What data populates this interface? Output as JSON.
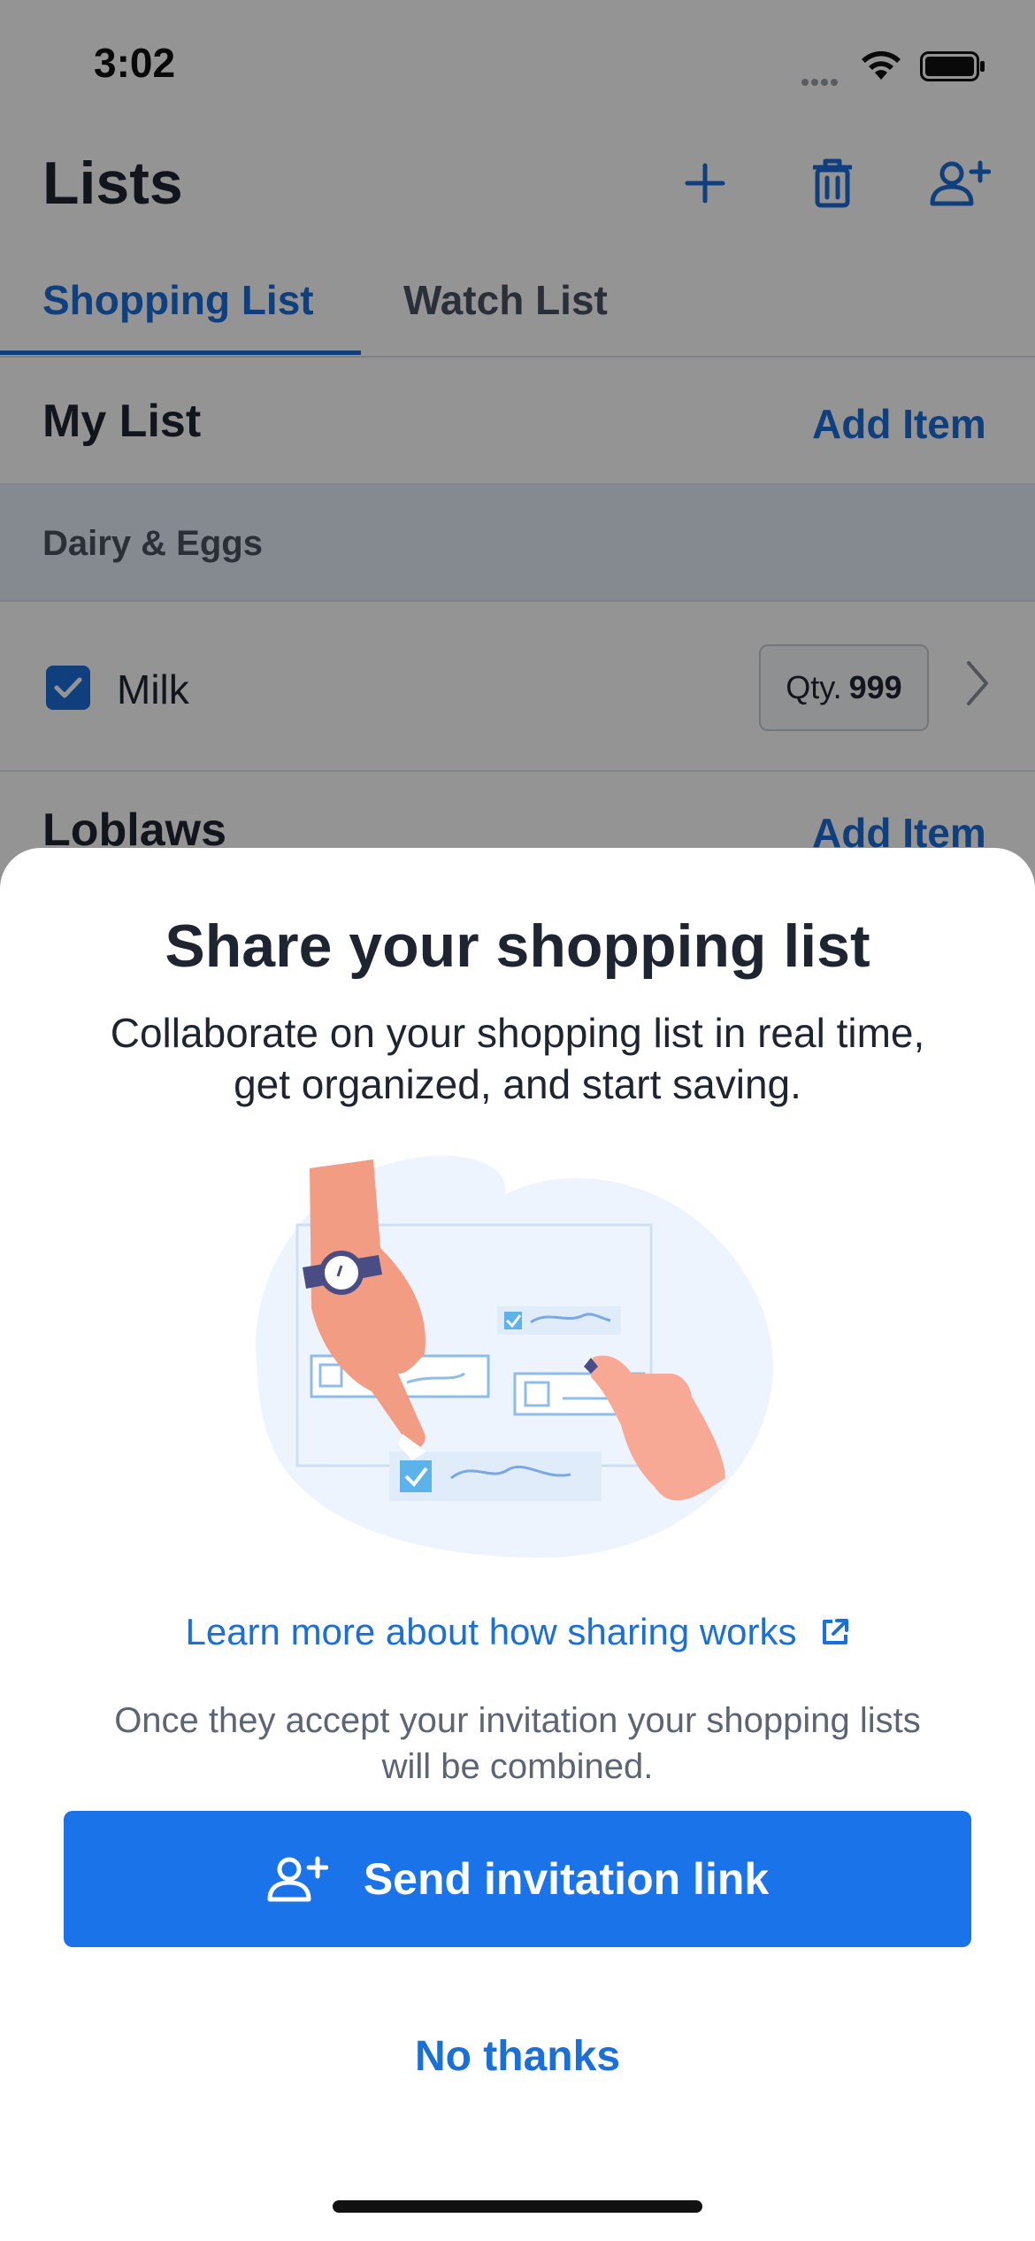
{
  "status_bar": {
    "time": "3:02"
  },
  "header": {
    "title": "Lists",
    "icons": [
      "plus-icon",
      "trash-icon",
      "person-add-icon"
    ]
  },
  "tabs": [
    {
      "label": "Shopping List",
      "active": true
    },
    {
      "label": "Watch List",
      "active": false
    }
  ],
  "lists": [
    {
      "title": "My List",
      "add_label": "Add Item",
      "sections": [
        {
          "name": "Dairy & Eggs",
          "items": [
            {
              "name": "Milk",
              "checked": true,
              "qty_label": "Qty.",
              "qty_value": "999"
            }
          ]
        }
      ]
    },
    {
      "title": "Loblaws",
      "add_label": "Add Item"
    }
  ],
  "sheet": {
    "title": "Share your shopping list",
    "description_line1": "Collaborate on your shopping list in real time,",
    "description_line2": "get organized, and start saving.",
    "learn_more": "Learn more about how sharing works",
    "note_line1": "Once they accept your invitation your shopping lists",
    "note_line2": "will be combined.",
    "send_button": "Send invitation link",
    "dismiss_button": "No thanks"
  },
  "colors": {
    "accent": "#1a73e8",
    "link": "#1a6fd8",
    "overlay": "rgba(0,0,0,0.42)",
    "text": "#1f2530",
    "muted": "#5c6573"
  }
}
